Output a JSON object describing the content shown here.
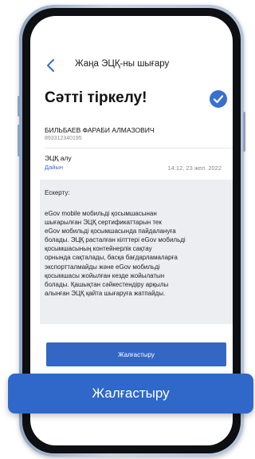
{
  "header": {
    "title": "Жаңа ЭЦҚ-ны шығару",
    "back_icon": "chevron-left-icon"
  },
  "success": {
    "title": "Сәтті тіркелу!",
    "icon": "check-circle-icon",
    "icon_color": "#3a6fd1"
  },
  "user": {
    "full_name": "БИЛЬБАЕВ ФАРАБИ АЛМАЗОВИЧ",
    "id": "893312340195"
  },
  "signature_row": {
    "label": "ЭЦҚ алу",
    "status": "Дайын",
    "datetime": "14:12, 23 жел. 2022"
  },
  "note": {
    "title": "Ескерту:",
    "lines": [
      "eGov mobile мобильді қосымшасынан",
      "шығарылған ЭЦҚ сертификаттарын тек",
      "eGov мобильді қосымшасында пайдалануға",
      "болады. ЭЦҚ расталған кілттері eGov мобильді",
      "қосымшасының контейнерлік сақтау",
      "орнында сақталады, басқа бағдарламаларға",
      "экспортталмайды және eGov мобильді",
      "қосымшасы жойылған кезде жойылатын",
      "болады. Қашықтан сәйкестендіру арқылы",
      "алынған ЭЦҚ қайта шығаруға жатпайды."
    ]
  },
  "buttons": {
    "continue_label": "Жалғастыру",
    "continue_overlay_label": "Жалғастыру"
  },
  "colors": {
    "primary": "#3467c4",
    "accent_blue": "#3a6fd1"
  }
}
